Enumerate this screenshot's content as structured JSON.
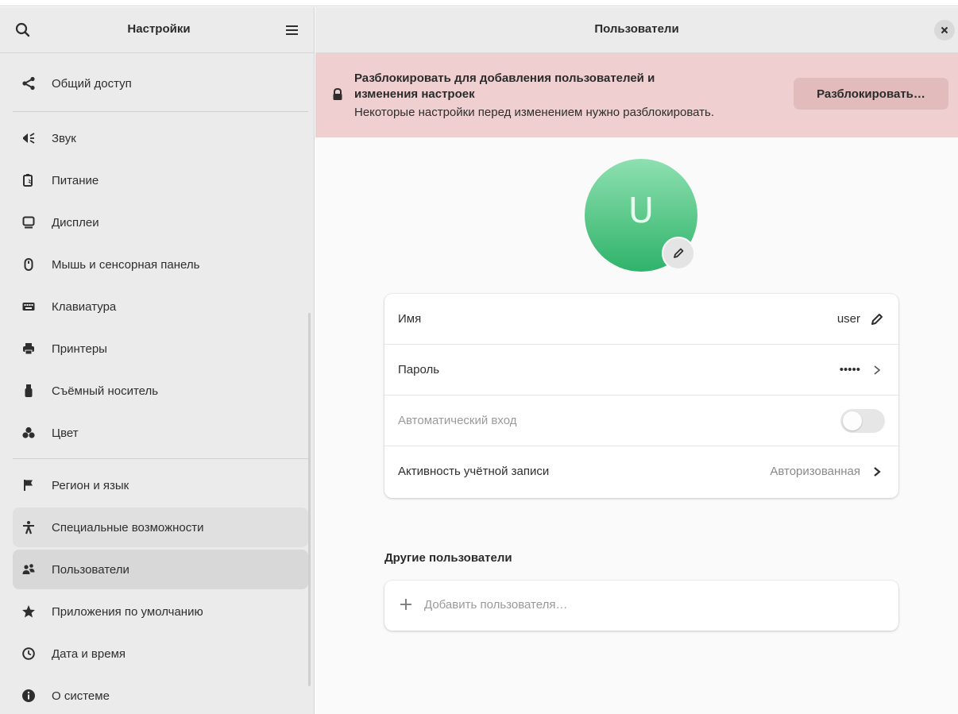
{
  "sidebar": {
    "title": "Настройки",
    "items": [
      {
        "label": "Общий доступ",
        "icon": "share-icon"
      },
      {
        "label": "Звук",
        "icon": "speaker-icon"
      },
      {
        "label": "Питание",
        "icon": "battery-power-icon"
      },
      {
        "label": "Дисплеи",
        "icon": "display-icon"
      },
      {
        "label": "Мышь и сенсорная панель",
        "icon": "mouse-icon"
      },
      {
        "label": "Клавиатура",
        "icon": "keyboard-icon"
      },
      {
        "label": "Принтеры",
        "icon": "printer-icon"
      },
      {
        "label": "Съёмный носитель",
        "icon": "usb-icon"
      },
      {
        "label": "Цвет",
        "icon": "color-icon"
      },
      {
        "label": "Регион и язык",
        "icon": "flag-icon"
      },
      {
        "label": "Специальные возможности",
        "icon": "accessibility-icon"
      },
      {
        "label": "Пользователи",
        "icon": "users-icon"
      },
      {
        "label": "Приложения по умолчанию",
        "icon": "star-icon"
      },
      {
        "label": "Дата и время",
        "icon": "clock-icon"
      },
      {
        "label": "О системе",
        "icon": "info-icon"
      }
    ],
    "selected": "Пользователи"
  },
  "main": {
    "title": "Пользователи",
    "banner": {
      "title": "Разблокировать для добавления пользователей и изменения настроек",
      "subtitle": "Некоторые настройки перед изменением нужно разблокировать.",
      "button": "Разблокировать…",
      "color": "#f0cfd0"
    },
    "avatar": {
      "initial": "U",
      "color": "#2fb36a"
    },
    "rows": {
      "name": {
        "label": "Имя",
        "value": "user"
      },
      "password": {
        "label": "Пароль",
        "value": "•••••"
      },
      "autologin": {
        "label": "Автоматический вход",
        "enabled": false
      },
      "activity": {
        "label": "Активность учётной записи",
        "value": "Авторизованная"
      }
    },
    "other_users": {
      "title": "Другие пользователи",
      "add_label": "Добавить пользователя…"
    }
  }
}
